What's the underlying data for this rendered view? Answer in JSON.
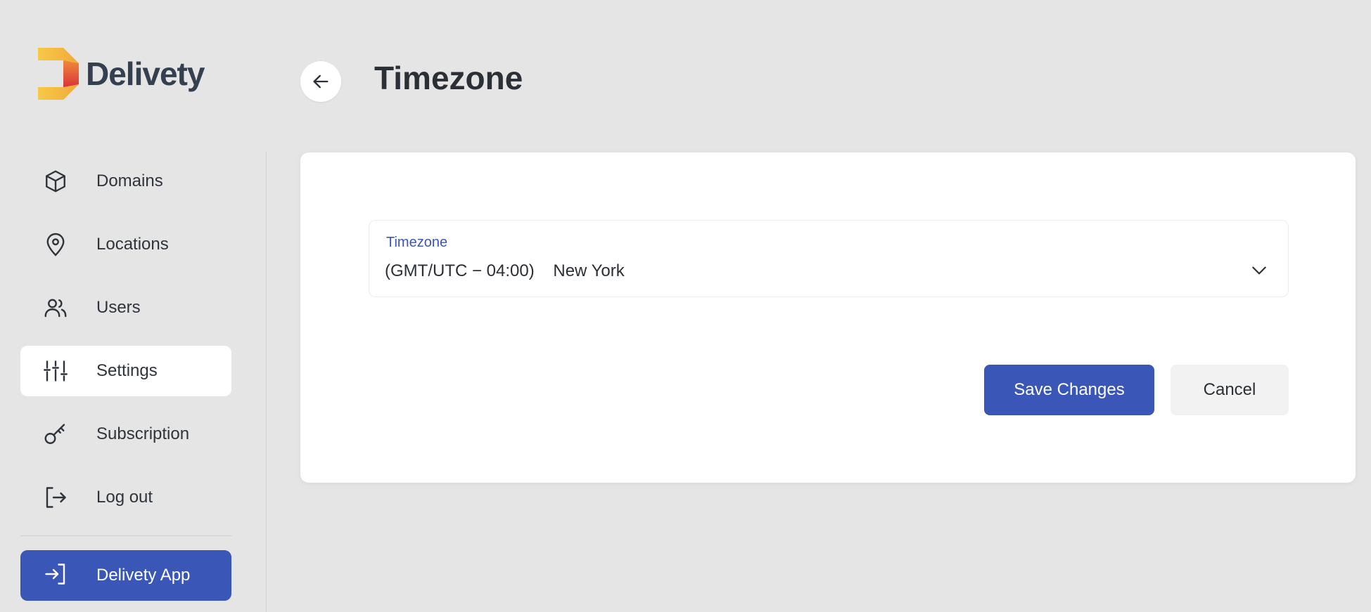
{
  "brand": {
    "name": "Delivety"
  },
  "header": {
    "title": "Timezone",
    "back_icon": "arrow-left-icon"
  },
  "sidebar": {
    "items": [
      {
        "label": "Domains",
        "icon": "cube-icon",
        "active": false
      },
      {
        "label": "Locations",
        "icon": "map-pin-icon",
        "active": false
      },
      {
        "label": "Users",
        "icon": "users-icon",
        "active": false
      },
      {
        "label": "Settings",
        "icon": "sliders-icon",
        "active": true
      },
      {
        "label": "Subscription",
        "icon": "key-icon",
        "active": false
      },
      {
        "label": "Log out",
        "icon": "logout-icon",
        "active": false
      }
    ],
    "app_button": {
      "label": "Delivety App",
      "icon": "login-icon"
    }
  },
  "form": {
    "timezone": {
      "label": "Timezone",
      "value": "(GMT/UTC − 04:00)    New York"
    },
    "save_label": "Save Changes",
    "cancel_label": "Cancel"
  },
  "colors": {
    "accent": "#3a57b8",
    "background": "#e5e5e5",
    "card": "#ffffff",
    "logo_yellow": "#f5c33b",
    "logo_red": "#e0453a"
  }
}
